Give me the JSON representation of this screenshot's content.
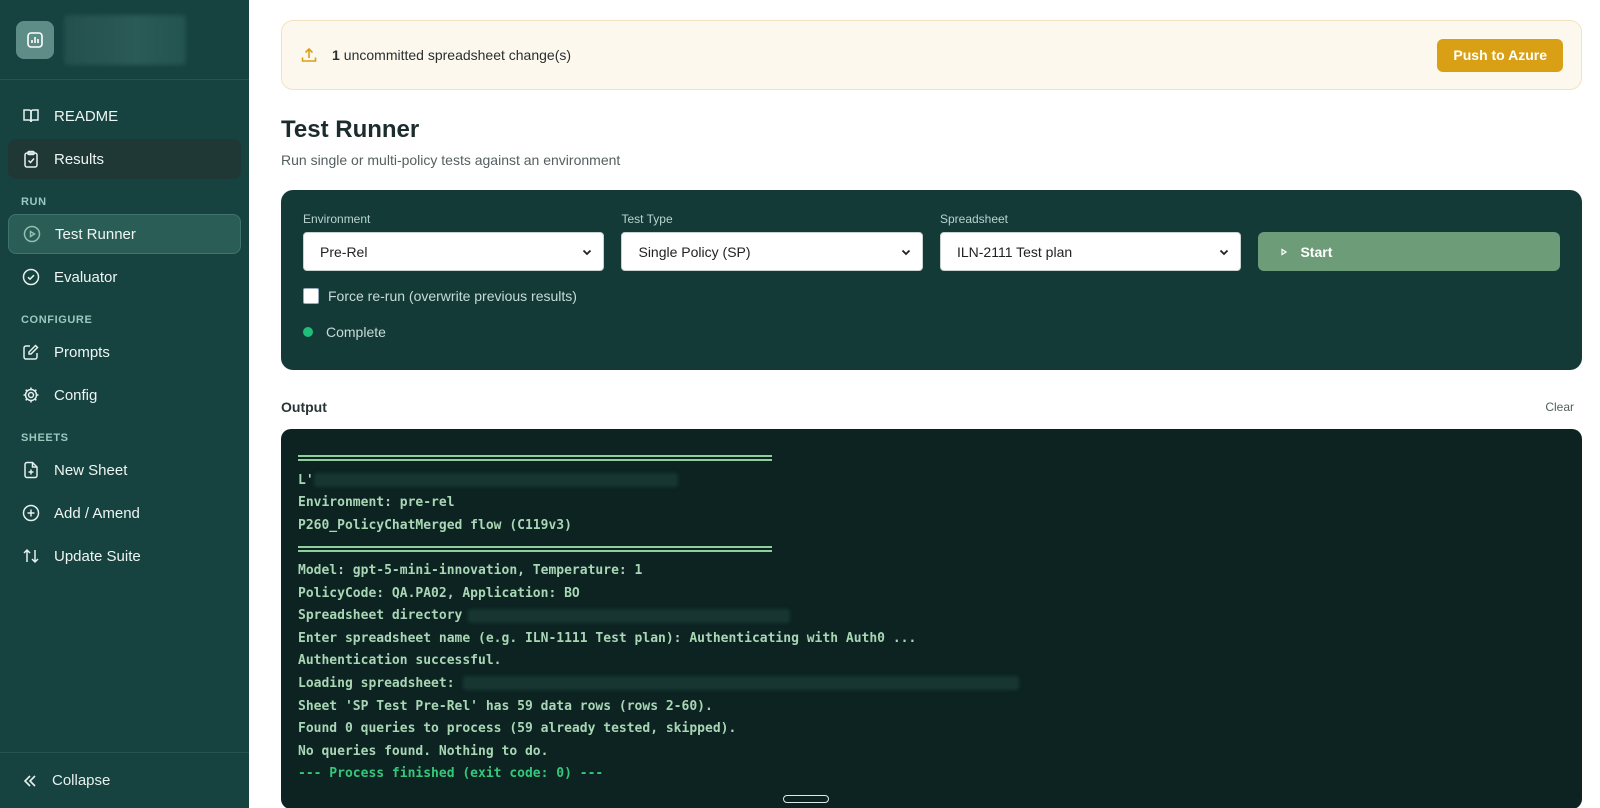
{
  "sidebar": {
    "items_top": [
      {
        "label": "README",
        "icon": "book-icon"
      },
      {
        "label": "Results",
        "icon": "clipboard-icon"
      }
    ],
    "sections": [
      {
        "label": "RUN",
        "items": [
          {
            "label": "Test Runner",
            "icon": "play-circle-icon",
            "active": true
          },
          {
            "label": "Evaluator",
            "icon": "check-circle-icon"
          }
        ]
      },
      {
        "label": "CONFIGURE",
        "items": [
          {
            "label": "Prompts",
            "icon": "edit-icon"
          },
          {
            "label": "Config",
            "icon": "gear-icon"
          }
        ]
      },
      {
        "label": "SHEETS",
        "items": [
          {
            "label": "New Sheet",
            "icon": "file-plus-icon"
          },
          {
            "label": "Add / Amend",
            "icon": "plus-circle-icon"
          },
          {
            "label": "Update Suite",
            "icon": "sort-arrows-icon"
          }
        ]
      }
    ],
    "collapse_label": "Collapse"
  },
  "banner": {
    "count": "1",
    "text": "uncommitted spreadsheet change(s)",
    "button": "Push to Azure"
  },
  "page": {
    "title": "Test Runner",
    "subtitle": "Run single or multi-policy tests against an environment"
  },
  "panel": {
    "environment": {
      "label": "Environment",
      "value": "Pre-Rel"
    },
    "test_type": {
      "label": "Test Type",
      "value": "Single Policy (SP)"
    },
    "spreadsheet": {
      "label": "Spreadsheet",
      "value": "ILN-2111 Test plan"
    },
    "start_label": "Start",
    "force_rerun_label": "Force re-run (overwrite previous results)",
    "status": "Complete"
  },
  "output": {
    "title": "Output",
    "clear_label": "Clear",
    "lines": {
      "l1": "L'",
      "env": "Environment: pre-rel",
      "flow": "P260_PolicyChatMerged flow (C119v3)",
      "model": "Model: gpt-5-mini-innovation, Temperature: 1",
      "policy": "PolicyCode: QA.PA02, Application: BO",
      "dir": "Spreadsheet directory",
      "enter": "Enter spreadsheet name (e.g. ILN-1111 Test plan): Authenticating with Auth0 ...",
      "auth": "Authentication successful.",
      "loading": "Loading spreadsheet:",
      "sheet": "Sheet 'SP Test Pre-Rel' has 59 data rows (rows 2-60).",
      "found": "Found 0 queries to process (59 already tested, skipped).",
      "none": "No queries found. Nothing to do.",
      "finished": "--- Process finished (exit code: 0) ---"
    }
  },
  "colors": {
    "sidebar_bg": "#16423f",
    "accent_gold": "#d9a016",
    "panel_bg": "#143a38",
    "start_green": "#6d9c78",
    "status_green": "#1fbf7a",
    "terminal_bg": "#0c2322"
  }
}
